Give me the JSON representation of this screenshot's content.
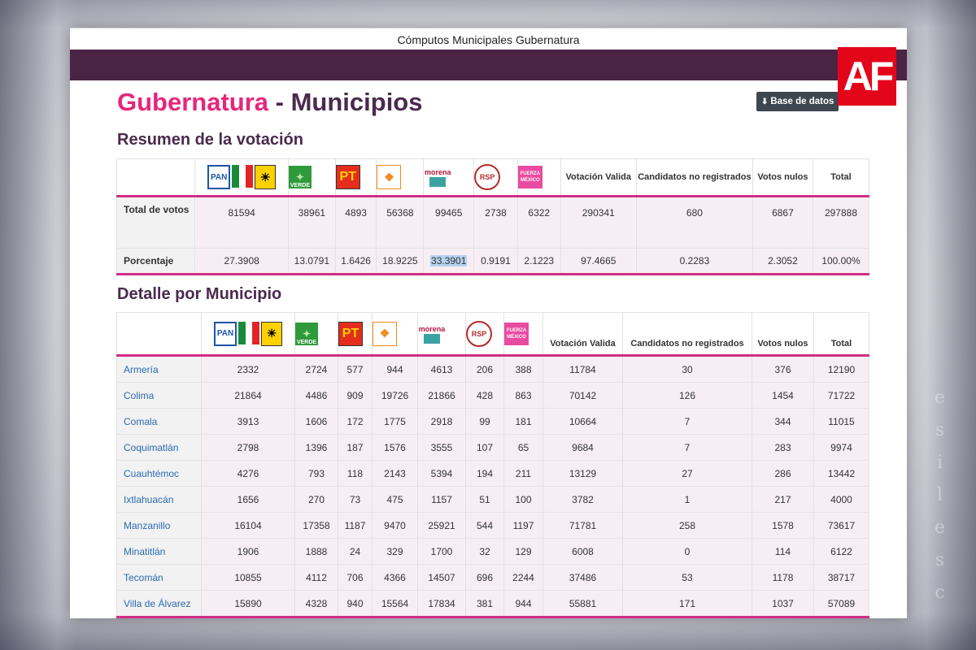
{
  "browser": {
    "title": "Cómputos Municipales Gubernatura"
  },
  "brand": {
    "logo_text": "AF",
    "logo_color": "#e3061b"
  },
  "page": {
    "title_part1": "Gubernatura",
    "title_separator": " - ",
    "title_part2": "Municipios",
    "download_button": "Base de datos",
    "accent_pink": "#e6267b",
    "accent_purple": "#4a2345"
  },
  "resumen": {
    "heading": "Resumen de la votación",
    "party_icons": [
      "pan-pri-prd-coalition-icon",
      "pvem-verde-icon",
      "pt-icon",
      "movimiento-ciudadano-icon",
      "morena-icon",
      "rsp-icon",
      "fuerza-mexico-icon"
    ],
    "headers": {
      "votacion_valida": "Votación Valida",
      "no_registrados": "Candidatos no registrados",
      "votos_nulos": "Votos nulos",
      "total": "Total"
    },
    "rows": [
      {
        "label": "Total de votos",
        "values": [
          "81594",
          "38961",
          "4893",
          "56368",
          "99465",
          "2738",
          "6322",
          "290341",
          "680",
          "6867",
          "297888"
        ]
      },
      {
        "label": "Porcentaje",
        "values": [
          "27.3908",
          "13.0791",
          "1.6426",
          "18.9225",
          "33.3901",
          "0.9191",
          "2.1223",
          "97.4665",
          "0.2283",
          "2.3052",
          "100.00%"
        ]
      }
    ]
  },
  "detalle": {
    "heading": "Detalle por Municipio",
    "headers": {
      "votacion_valida": "Votación Valida",
      "no_registrados": "Candidatos no registrados",
      "votos_nulos": "Votos nulos",
      "total": "Total"
    },
    "rows": [
      {
        "municipio": "Armería",
        "values": [
          "2332",
          "2724",
          "577",
          "944",
          "4613",
          "206",
          "388",
          "11784",
          "30",
          "376",
          "12190"
        ]
      },
      {
        "municipio": "Colima",
        "values": [
          "21864",
          "4486",
          "909",
          "19726",
          "21866",
          "428",
          "863",
          "70142",
          "126",
          "1454",
          "71722"
        ]
      },
      {
        "municipio": "Comala",
        "values": [
          "3913",
          "1606",
          "172",
          "1775",
          "2918",
          "99",
          "181",
          "10664",
          "7",
          "344",
          "11015"
        ]
      },
      {
        "municipio": "Coquimatlán",
        "values": [
          "2798",
          "1396",
          "187",
          "1576",
          "3555",
          "107",
          "65",
          "9684",
          "7",
          "283",
          "9974"
        ]
      },
      {
        "municipio": "Cuauhtémoc",
        "values": [
          "4276",
          "793",
          "118",
          "2143",
          "5394",
          "194",
          "211",
          "13129",
          "27",
          "286",
          "13442"
        ]
      },
      {
        "municipio": "Ixtlahuacán",
        "values": [
          "1656",
          "270",
          "73",
          "475",
          "1157",
          "51",
          "100",
          "3782",
          "1",
          "217",
          "4000"
        ]
      },
      {
        "municipio": "Manzanillo",
        "values": [
          "16104",
          "17358",
          "1187",
          "9470",
          "25921",
          "544",
          "1197",
          "71781",
          "258",
          "1578",
          "73617"
        ]
      },
      {
        "municipio": "Minatitlán",
        "values": [
          "1906",
          "1888",
          "24",
          "329",
          "1700",
          "32",
          "129",
          "6008",
          "0",
          "114",
          "6122"
        ]
      },
      {
        "municipio": "Tecomán",
        "values": [
          "10855",
          "4112",
          "706",
          "4366",
          "14507",
          "696",
          "2244",
          "37486",
          "53",
          "1178",
          "38717"
        ]
      },
      {
        "municipio": "Villa de Álvarez",
        "values": [
          "15890",
          "4328",
          "940",
          "15564",
          "17834",
          "381",
          "944",
          "55881",
          "171",
          "1037",
          "57089"
        ]
      }
    ]
  }
}
